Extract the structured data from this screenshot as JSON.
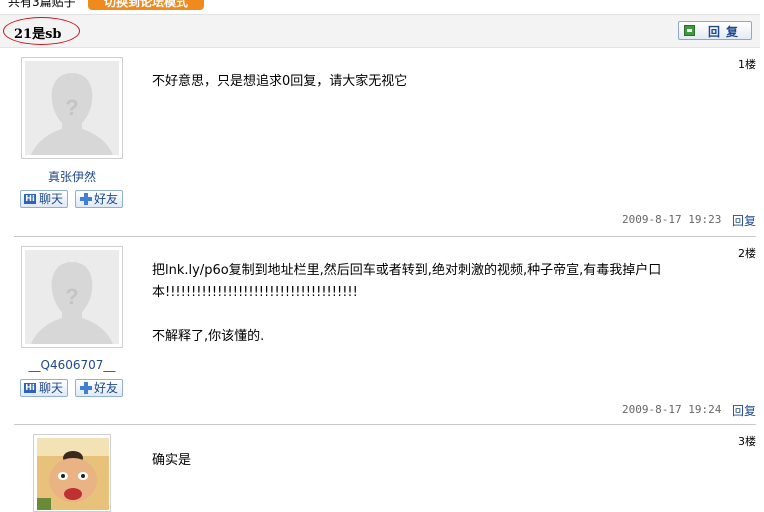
{
  "topbar": {
    "count_text": "共有3篇贴子",
    "orange_btn": "切换到论坛模式"
  },
  "thread": {
    "title": "21是sb",
    "reply_label": "回复"
  },
  "posts": [
    {
      "username": "真张伊然",
      "floor": "1楼",
      "content": [
        "不好意思，只是想追求0回复，请大家无视它"
      ],
      "time": "2009-8-17 19:23",
      "reply": "回复",
      "chat": "聊天",
      "friend": "好友",
      "avatar": "default-silhouette"
    },
    {
      "username": "__Q4606707__",
      "floor": "2楼",
      "content": [
        "把lnk.ly/p6o复制到地址栏里,然后回车或者转到,绝对刺激的视频,种子帝宣,有毒我掉户口",
        "本!!!!!!!!!!!!!!!!!!!!!!!!!!!!!!!!!!!!!",
        "",
        "不解释了,你该懂的."
      ],
      "time": "2009-8-17 19:24",
      "reply": "回复",
      "chat": "聊天",
      "friend": "好友",
      "avatar": "default-silhouette"
    },
    {
      "floor": "3楼",
      "content": [
        "确实是"
      ],
      "avatar": "cartoon-character"
    }
  ],
  "colors": {
    "link": "#1f4a8a",
    "accent": "#f08a1c",
    "highlight_ring": "#c8141e"
  }
}
